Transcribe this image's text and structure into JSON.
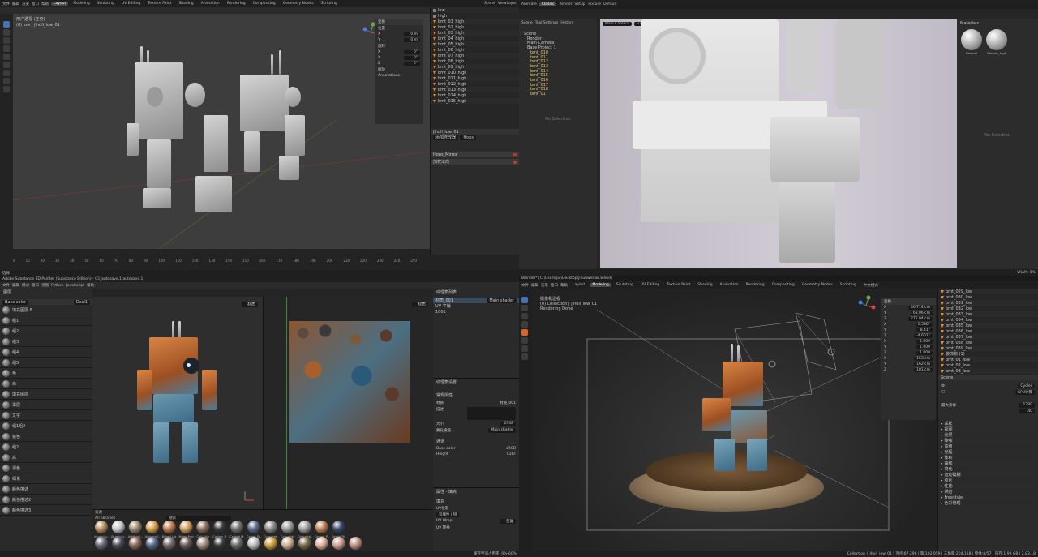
{
  "q1": {
    "menu": [
      "文件",
      "编辑",
      "渲染",
      "窗口",
      "帮助"
    ],
    "tabs": [
      "Layout",
      "Modeling",
      "Sculpting",
      "UV Editing",
      "Texture Paint",
      "Shading",
      "Animation",
      "Rendering",
      "Compositing",
      "Geometry Nodes",
      "Scripting"
    ],
    "viewport_info": [
      "用户透视 (正交)",
      "(0) low | jihuli_low_01"
    ],
    "scene_label": "Scene",
    "viewlayer_label": "ViewLayer",
    "npanel": {
      "title": "变换",
      "labels": [
        "位置",
        "旋转",
        "缩放"
      ],
      "x_label": "X",
      "y_label": "Y",
      "z_label": "Z",
      "zero": "0 m",
      "zero_deg": "0°",
      "annotations": "Annotations"
    },
    "outliner_items": [
      "low",
      "high",
      "bmt_01_high",
      "bmt_02_high",
      "bmt_03_high",
      "bmt_04_high",
      "bmt_05_high",
      "bmt_06_high",
      "bmt_07_high",
      "bmt_08_high",
      "bmt_09_high",
      "bmt_010_high",
      "bmt_011_high",
      "bmt_012_high",
      "bmt_013_high",
      "bmt_014_high",
      "bmt_015_high"
    ],
    "props": {
      "name": "jihuli_low_01",
      "mod1": "Hops_Mirror",
      "mod2": "加权法向",
      "btn1": "添加修改器",
      "btn2": "Hops"
    },
    "timeline_numbers": [
      "0",
      "10",
      "20",
      "30",
      "40",
      "50",
      "60",
      "70",
      "80",
      "90",
      "100",
      "110",
      "120",
      "130",
      "140",
      "150",
      "160",
      "170",
      "180",
      "190",
      "200",
      "210",
      "220",
      "230",
      "240",
      "250"
    ],
    "status": "选择"
  },
  "q2": {
    "menu": [
      "Animate",
      "Classic",
      "Render",
      "Setup",
      "Texture",
      "Default"
    ],
    "tabs": [
      "Scene",
      "Tool Settings",
      "History"
    ],
    "tree": [
      "Scene",
      "Render",
      "Main Camera",
      "Base Project 1",
      "bmt_010",
      "bmt_011",
      "bmt_012",
      "bmt_013",
      "bmt_014",
      "bmt_015",
      "bmt_016",
      "bmt_017",
      "bmt_018",
      "bmt_01"
    ],
    "camera_label": "Main Camera",
    "quality_label": "Full Quality",
    "no_selection": "No Selection",
    "materials_title": "Materials",
    "mat1": "Default",
    "mat2": "Default_high",
    "vram": "VRAM: 5%"
  },
  "q3": {
    "title": "Adobe Substance 3D Painter (Substance Edition) - 03_autosave.1.autosave.1",
    "menu": [
      "文件",
      "编辑",
      "模式",
      "窗口",
      "视图",
      "Python",
      "JavaScript",
      "帮助"
    ],
    "layers_title": "图层",
    "base_color": "Base color",
    "blend": "Dsel1",
    "layers": [
      "填充图层 8",
      "组1",
      "组2",
      "组3",
      "组4",
      "组5",
      "色",
      "白",
      "填充图层",
      "罩层",
      "文字",
      "组1组2",
      "装色",
      "组2",
      "高",
      "混色",
      "细化",
      "颜色描述",
      "颜色描述2",
      "颜色描述3"
    ],
    "shelf_title": "资源",
    "shelf_filter": "All libraries",
    "shelf_search": "搜索",
    "materials_row1": [
      "Aluminiu...",
      "Aluminiu...",
      "Artificial...",
      "Autumn L...",
      "Baked Lig...",
      "Brass Pure",
      "Calf Skin",
      "Carbon Fi...",
      "Coated M...",
      "Cobalt Pu...",
      "Concrete...",
      "Concrete...",
      "Concrete...",
      "Copper Pl...",
      "Denim Ri..."
    ],
    "materials_row2": [
      "Fabric Ba...",
      "Fabric Ba...",
      "Fabric Ba...",
      "Fabric De...",
      "Fabric Kn...",
      "Fabric Ro...",
      "Fabric Soft...",
      "Footprints",
      "Gilt Rub...",
      "Glitter",
      "Gold Pure",
      "Gouache...",
      "Ground G...",
      "Human B...",
      "Human B...",
      "Human C..."
    ],
    "viewport_mode": "材质",
    "viewport2_mode": "材质",
    "texset_title": "纹理集列表",
    "texset_item": "材质_001",
    "texset_shader": "Main shader",
    "uv_label": "UV 平铺",
    "uv_tile": "1001",
    "settings_title": "纹理集设置",
    "settings_section": "常规属性",
    "material_label": "材质",
    "material_value": "材质_001",
    "desc_label": "描述",
    "size_label": "大小",
    "size_value": "2048",
    "normal_label": "要化通道",
    "normal_value": "Main shader",
    "channels": "通道",
    "ch1": "Base color",
    "ch1_val": "sRGB",
    "ch2": "Height",
    "ch2_val": "L16F",
    "prop_title": "属性 - 填充",
    "prop_section": "填充",
    "proj": "UV投影",
    "filter": "双线性 | 锐",
    "wrap": "UV Wrap",
    "wrap_val": "重复",
    "uv_trans": "UV 转换",
    "status": "缓存空间占用率: 0%  60%"
  },
  "q4": {
    "title": "Blender* [C:\\Users\\pc\\Desktop\\jihuawenan.blend]",
    "menu": [
      "文件",
      "编辑",
      "渲染",
      "窗口",
      "帮助"
    ],
    "tabs": [
      "Layout",
      "Modeling",
      "Sculpting",
      "UV Editing",
      "Texture Paint",
      "Shading",
      "Animation",
      "Rendering",
      "Compositing",
      "Geometry Nodes",
      "Scripting",
      "中文模式"
    ],
    "viewport_info": [
      "摄像机透视",
      "(0) Collection | jihuli_low_01",
      "Rendering Done"
    ],
    "npanel": {
      "title": "变换",
      "loc": [
        "46.714 cm",
        "68.06 cm",
        "275.94 cm"
      ],
      "rot": [
        "0.536°",
        "8.41°",
        "-4.601°"
      ],
      "scale": [
        "1.000",
        "1.000",
        "1.000"
      ],
      "dim": [
        "153 cm",
        "162 cm",
        "101 cm"
      ]
    },
    "outliner_items": [
      "bmt_029_low",
      "bmt_030_low",
      "bmt_031_low",
      "bmt_032_low",
      "bmt_033_low",
      "bmt_034_low",
      "bmt_035_low",
      "bmt_036_low",
      "bmt_037_low",
      "bmt_038_low",
      "bmt_039_low",
      "装饰物 (1)",
      "bmt_01_low",
      "bmt_02_low",
      "bmt_03_low"
    ],
    "props_title": "Scene",
    "render_engine": "Cycles",
    "device": "GPU计算",
    "sections": [
      "采样",
      "视图",
      "光照",
      "降噪",
      "高级",
      "光程",
      "体积",
      "曲线",
      "简化",
      "运动模糊",
      "胶片",
      "性能",
      "烘焙",
      "Freestyle",
      "色彩管理"
    ],
    "samples_label": "最大采样",
    "samples": "1280",
    "noise": "40",
    "status": "Collection | jihuli_low_01 | 顶点:67,296 | 面:102,059 | 三角面:204,118 | 物体:0/57 | 内存:1.99 GB | 2.83.18"
  }
}
